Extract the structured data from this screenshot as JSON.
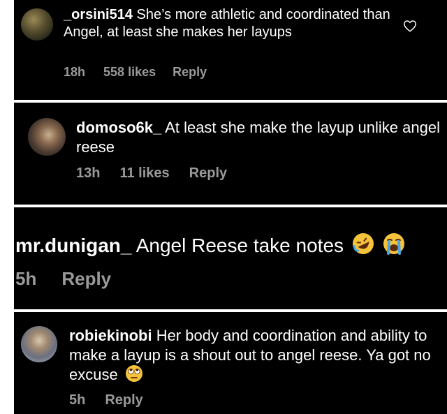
{
  "comments": [
    {
      "username": "_orsini514",
      "text": "She’s more athletic and coordinated than Angel, at least she makes her layups",
      "time": "18h",
      "likes": "558 likes",
      "reply": "Reply",
      "avatar_icon": "user-avatar-photo",
      "like_icon": "heart-outline-icon"
    },
    {
      "username": "domoso6k_",
      "text": "At least she make the layup unlike angel reese",
      "time": "13h",
      "likes": "11 likes",
      "reply": "Reply",
      "avatar_icon": "user-avatar-photo"
    },
    {
      "username": "mr.dunigan_",
      "text": "Angel Reese take notes",
      "emojis": [
        "rofl-emoji",
        "loudly-crying-emoji"
      ],
      "time": "5h",
      "reply": "Reply"
    },
    {
      "username": "robiekinobi",
      "text": "Her body and coordination and ability to make a layup is a shout out to angel reese. Ya got no excuse",
      "emojis": [
        "eye-roll-emoji"
      ],
      "time": "5h",
      "reply": "Reply",
      "avatar_icon": "user-avatar-photo"
    }
  ]
}
